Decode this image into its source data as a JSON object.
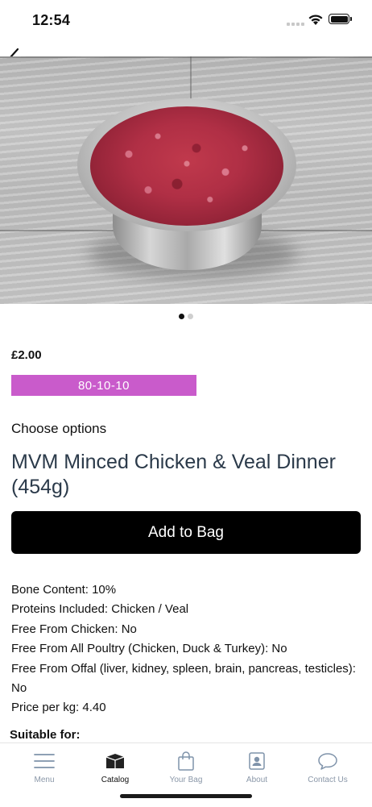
{
  "status_bar": {
    "time": "12:54"
  },
  "product": {
    "price": "£2.00",
    "ratio_badge": "80-10-10",
    "choose_options": "Choose options",
    "title": "MVM Minced Chicken & Veal Dinner (454g)",
    "add_to_bag_label": "Add to Bag",
    "image_pages": {
      "count": 2,
      "active_index": 0
    },
    "details": [
      "Bone Content: 10%",
      "Proteins Included: Chicken / Veal",
      "Free From Chicken: No",
      "Free From All Poultry (Chicken, Duck & Turkey): No",
      "Free From Offal (liver, kidney, spleen, brain, pancreas, testicles): No",
      "Price per kg: 4.40"
    ],
    "suitable_for_label": "Suitable for:"
  },
  "tab_bar": {
    "items": [
      {
        "label": "Menu",
        "icon": "menu-icon",
        "active": false
      },
      {
        "label": "Catalog",
        "icon": "catalog-box-icon",
        "active": true
      },
      {
        "label": "Your Bag",
        "icon": "shopping-bag-icon",
        "active": false
      },
      {
        "label": "About",
        "icon": "about-badge-icon",
        "active": false
      },
      {
        "label": "Contact Us",
        "icon": "chat-bubble-icon",
        "active": false
      }
    ]
  },
  "colors": {
    "badge": "#c95bcb",
    "button": "#000000",
    "title": "#2b3a4a",
    "tab_inactive": "#8a97a8",
    "tab_active": "#111111"
  }
}
